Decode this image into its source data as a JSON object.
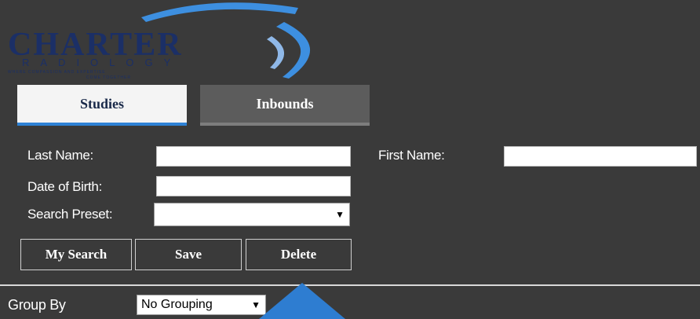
{
  "logo": {
    "name": "CHARTER",
    "sub": "RADIOLOGY",
    "tagline": "WHERE COMPASSION AND EXPERTISE",
    "tagline2": "COME TOGETHER"
  },
  "tabs": [
    {
      "label": "Studies",
      "active": true
    },
    {
      "label": "Inbounds",
      "active": false
    }
  ],
  "form": {
    "last_name_label": "Last Name:",
    "last_name_value": "",
    "first_name_label": "First Name:",
    "first_name_value": "",
    "dob_label": "Date of Birth:",
    "dob_value": "",
    "preset_label": "Search Preset:",
    "preset_value": ""
  },
  "buttons": {
    "my_search": "My Search",
    "save": "Save",
    "delete": "Delete"
  },
  "group_by": {
    "label": "Group By",
    "value": "No Grouping"
  },
  "colors": {
    "background": "#3a3a3a",
    "accent": "#2e82d6",
    "logo_navy": "#1b2f66",
    "logo_blue": "#3d8fe0"
  }
}
